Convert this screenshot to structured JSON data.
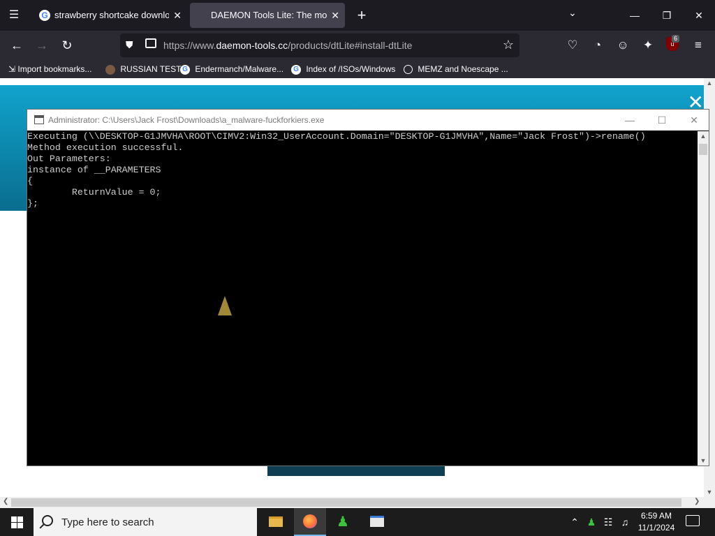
{
  "browser": {
    "tabs": [
      {
        "title": "strawberry shortcake download",
        "active": false
      },
      {
        "title": "DAEMON Tools Lite: The most p",
        "active": true
      }
    ],
    "url_prefix": "https://www.",
    "url_domain": "daemon-tools.cc",
    "url_suffix": "/products/dtLite#install-dtLite",
    "ublock_count": "6",
    "bookmarks": [
      {
        "label": "Import bookmarks...",
        "icon": "import-icon"
      },
      {
        "label": "RUSSIAN TEST",
        "icon": "swirl-icon"
      },
      {
        "label": "Endermanch/Malware...",
        "icon": "google-icon"
      },
      {
        "label": "Index of /ISOs/Windows",
        "icon": "google-icon"
      },
      {
        "label": "MEMZ and Noescape ...",
        "icon": "globe-icon"
      }
    ]
  },
  "console": {
    "title": "Administrator: C:\\Users\\Jack Frost\\Downloads\\a_malware-fuckforkiers.exe",
    "lines": [
      "Executing (\\\\DESKTOP-G1JMVHA\\ROOT\\CIMV2:Win32_UserAccount.Domain=\"DESKTOP-G1JMVHA\",Name=\"Jack Frost\")->rename()",
      "Method execution successful.",
      "Out Parameters:",
      "instance of __PARAMETERS",
      "{",
      "        ReturnValue = 0;",
      "};"
    ]
  },
  "taskbar": {
    "search_placeholder": "Type here to search",
    "time": "6:59 AM",
    "date": "11/1/2024"
  }
}
